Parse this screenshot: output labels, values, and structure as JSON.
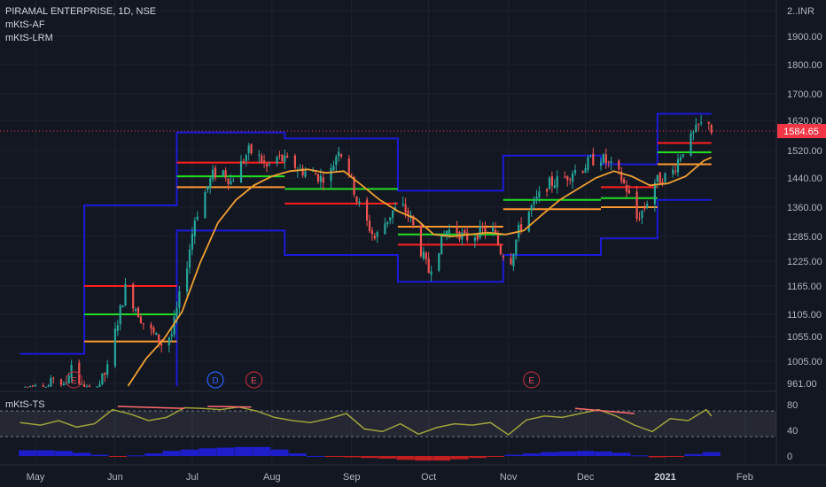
{
  "header": {
    "title": "PIRAMAL ENTERPRISE, 1D, NSE",
    "indicators": [
      "mKtS-AF",
      "mKtS-LRM"
    ],
    "currency": "INR",
    "sub_title": "mKtS-TS"
  },
  "colors": {
    "background": "#131722",
    "up": "#26a69a",
    "down": "#ef5350",
    "channel": "#1a1ad8",
    "ma": "#f0a032",
    "level_red": "#ff1f1f",
    "level_green": "#22dd22",
    "level_orange": "#ff9830",
    "ts_line": "#9fa33a",
    "histogram_pos": "#2020e8",
    "histogram_neg": "#e02020",
    "price_tag": "#f23645"
  },
  "chart_data": {
    "type": "candlestick",
    "title": "PIRAMAL ENTERPRISE, 1D, NSE",
    "currency": "INR",
    "last_price": "1584.65",
    "ylim": [
      945,
      2020
    ],
    "y_ticks": [
      "2...",
      "1900.00",
      "1800.00",
      "1700.00",
      "1620.00",
      "1520.00",
      "1440.00",
      "1360.00",
      "1285.00",
      "1225.00",
      "1165.00",
      "1105.00",
      "1055.00",
      "1005.00",
      "961.00"
    ],
    "x_ticks": [
      "May",
      "Jun",
      "Jul",
      "Aug",
      "Sep",
      "Oct",
      "Nov",
      "Dec",
      "2021",
      "Feb"
    ],
    "events": [
      {
        "label": "E",
        "x": "2020-05-16"
      },
      {
        "label": "D",
        "x": "2020-07-10"
      },
      {
        "label": "E",
        "x": "2020-07-25"
      },
      {
        "label": "E",
        "x": "2020-11-10"
      }
    ],
    "price_path": [
      [
        "2020-04-28",
        940
      ],
      [
        "2020-05-01",
        960
      ],
      [
        "2020-05-05",
        930
      ],
      [
        "2020-05-08",
        975
      ],
      [
        "2020-05-12",
        950
      ],
      [
        "2020-05-15",
        1000
      ],
      [
        "2020-05-19",
        950
      ],
      [
        "2020-05-22",
        930
      ],
      [
        "2020-05-26",
        960
      ],
      [
        "2020-05-29",
        990
      ],
      [
        "2020-06-02",
        1090
      ],
      [
        "2020-06-05",
        1160
      ],
      [
        "2020-06-09",
        1120
      ],
      [
        "2020-06-12",
        1085
      ],
      [
        "2020-06-16",
        1060
      ],
      [
        "2020-06-19",
        1040
      ],
      [
        "2020-06-23",
        1060
      ],
      [
        "2020-06-26",
        1140
      ],
      [
        "2020-06-29",
        1220
      ],
      [
        "2020-07-02",
        1330
      ],
      [
        "2020-07-06",
        1400
      ],
      [
        "2020-07-09",
        1450
      ],
      [
        "2020-07-13",
        1460
      ],
      [
        "2020-07-16",
        1430
      ],
      [
        "2020-07-20",
        1480
      ],
      [
        "2020-07-23",
        1520
      ],
      [
        "2020-07-27",
        1500
      ],
      [
        "2020-07-30",
        1470
      ],
      [
        "2020-08-03",
        1500
      ],
      [
        "2020-08-06",
        1490
      ],
      [
        "2020-08-10",
        1475
      ],
      [
        "2020-08-13",
        1460
      ],
      [
        "2020-08-17",
        1455
      ],
      [
        "2020-08-20",
        1440
      ],
      [
        "2020-08-24",
        1460
      ],
      [
        "2020-08-27",
        1530
      ],
      [
        "2020-08-31",
        1460
      ],
      [
        "2020-09-03",
        1380
      ],
      [
        "2020-09-07",
        1320
      ],
      [
        "2020-09-10",
        1280
      ],
      [
        "2020-09-14",
        1320
      ],
      [
        "2020-09-17",
        1350
      ],
      [
        "2020-09-21",
        1360
      ],
      [
        "2020-09-24",
        1330
      ],
      [
        "2020-09-28",
        1250
      ],
      [
        "2020-10-01",
        1200
      ],
      [
        "2020-10-05",
        1260
      ],
      [
        "2020-10-08",
        1300
      ],
      [
        "2020-10-12",
        1300
      ],
      [
        "2020-10-15",
        1280
      ],
      [
        "2020-10-19",
        1290
      ],
      [
        "2020-10-22",
        1300
      ],
      [
        "2020-10-26",
        1300
      ],
      [
        "2020-10-29",
        1250
      ],
      [
        "2020-11-02",
        1230
      ],
      [
        "2020-11-05",
        1300
      ],
      [
        "2020-11-09",
        1350
      ],
      [
        "2020-11-12",
        1380
      ],
      [
        "2020-11-16",
        1420
      ],
      [
        "2020-11-19",
        1430
      ],
      [
        "2020-11-23",
        1440
      ],
      [
        "2020-11-26",
        1460
      ],
      [
        "2020-11-30",
        1470
      ],
      [
        "2020-12-03",
        1490
      ],
      [
        "2020-12-07",
        1500
      ],
      [
        "2020-12-10",
        1480
      ],
      [
        "2020-12-14",
        1450
      ],
      [
        "2020-12-17",
        1410
      ],
      [
        "2020-12-21",
        1330
      ],
      [
        "2020-12-24",
        1360
      ],
      [
        "2020-12-28",
        1430
      ],
      [
        "2020-12-31",
        1440
      ],
      [
        "2021-01-04",
        1460
      ],
      [
        "2021-01-07",
        1510
      ],
      [
        "2021-01-11",
        1560
      ],
      [
        "2021-01-14",
        1600
      ],
      [
        "2021-01-18",
        1620
      ],
      [
        "2021-01-19",
        1585
      ]
    ],
    "ma_path": [
      [
        "2020-06-06",
        945
      ],
      [
        "2020-06-13",
        1010
      ],
      [
        "2020-06-20",
        1050
      ],
      [
        "2020-06-27",
        1110
      ],
      [
        "2020-07-04",
        1220
      ],
      [
        "2020-07-11",
        1320
      ],
      [
        "2020-07-18",
        1380
      ],
      [
        "2020-07-25",
        1420
      ],
      [
        "2020-08-01",
        1445
      ],
      [
        "2020-08-08",
        1460
      ],
      [
        "2020-08-15",
        1465
      ],
      [
        "2020-08-22",
        1455
      ],
      [
        "2020-08-29",
        1460
      ],
      [
        "2020-09-05",
        1420
      ],
      [
        "2020-09-12",
        1380
      ],
      [
        "2020-09-19",
        1350
      ],
      [
        "2020-09-26",
        1330
      ],
      [
        "2020-10-03",
        1290
      ],
      [
        "2020-10-10",
        1285
      ],
      [
        "2020-10-17",
        1290
      ],
      [
        "2020-10-24",
        1295
      ],
      [
        "2020-10-31",
        1290
      ],
      [
        "2020-11-07",
        1300
      ],
      [
        "2020-11-14",
        1340
      ],
      [
        "2020-11-21",
        1380
      ],
      [
        "2020-11-28",
        1410
      ],
      [
        "2020-12-05",
        1440
      ],
      [
        "2020-12-12",
        1460
      ],
      [
        "2020-12-19",
        1445
      ],
      [
        "2020-12-26",
        1420
      ],
      [
        "2021-01-02",
        1425
      ],
      [
        "2021-01-09",
        1445
      ],
      [
        "2021-01-16",
        1490
      ],
      [
        "2021-01-19",
        1500
      ]
    ],
    "channel_upper": [
      [
        "2020-04-25",
        1020
      ],
      [
        "2020-05-20",
        1020
      ],
      [
        "2020-05-20",
        1365
      ],
      [
        "2020-06-25",
        1365
      ],
      [
        "2020-06-25",
        1580
      ],
      [
        "2020-08-06",
        1580
      ],
      [
        "2020-08-06",
        1560
      ],
      [
        "2020-09-19",
        1560
      ],
      [
        "2020-09-19",
        1405
      ],
      [
        "2020-10-30",
        1405
      ],
      [
        "2020-10-30",
        1505
      ],
      [
        "2020-12-07",
        1505
      ],
      [
        "2020-12-07",
        1480
      ],
      [
        "2020-12-29",
        1480
      ],
      [
        "2020-12-29",
        1640
      ],
      [
        "2021-01-19",
        1640
      ]
    ],
    "channel_lower": [
      [
        "2020-06-25",
        945
      ],
      [
        "2020-06-25",
        1300
      ],
      [
        "2020-08-06",
        1300
      ],
      [
        "2020-08-06",
        1240
      ],
      [
        "2020-09-19",
        1240
      ],
      [
        "2020-09-19",
        1175
      ],
      [
        "2020-10-30",
        1175
      ],
      [
        "2020-10-30",
        1240
      ],
      [
        "2020-12-07",
        1240
      ],
      [
        "2020-12-07",
        1280
      ],
      [
        "2020-12-29",
        1280
      ],
      [
        "2020-12-29",
        1380
      ],
      [
        "2021-01-19",
        1380
      ]
    ],
    "levels": [
      {
        "color": "red",
        "from": "2020-05-20",
        "to": "2020-06-25",
        "y": 1165
      },
      {
        "color": "green",
        "from": "2020-05-20",
        "to": "2020-06-25",
        "y": 1105
      },
      {
        "color": "orange",
        "from": "2020-05-20",
        "to": "2020-06-25",
        "y": 1045
      },
      {
        "color": "red",
        "from": "2020-06-25",
        "to": "2020-08-06",
        "y": 1485
      },
      {
        "color": "green",
        "from": "2020-06-25",
        "to": "2020-08-06",
        "y": 1445
      },
      {
        "color": "orange",
        "from": "2020-06-25",
        "to": "2020-08-06",
        "y": 1415
      },
      {
        "color": "green",
        "from": "2020-08-06",
        "to": "2020-09-19",
        "y": 1410
      },
      {
        "color": "red",
        "from": "2020-08-06",
        "to": "2020-09-19",
        "y": 1370
      },
      {
        "color": "orange",
        "from": "2020-09-19",
        "to": "2020-10-30",
        "y": 1310
      },
      {
        "color": "green",
        "from": "2020-09-19",
        "to": "2020-10-30",
        "y": 1290
      },
      {
        "color": "red",
        "from": "2020-09-19",
        "to": "2020-10-30",
        "y": 1265
      },
      {
        "color": "green",
        "from": "2020-10-30",
        "to": "2020-12-07",
        "y": 1380
      },
      {
        "color": "orange",
        "from": "2020-10-30",
        "to": "2020-12-07",
        "y": 1355
      },
      {
        "color": "red",
        "from": "2020-12-07",
        "to": "2020-12-29",
        "y": 1415
      },
      {
        "color": "green",
        "from": "2020-12-07",
        "to": "2020-12-29",
        "y": 1385
      },
      {
        "color": "orange",
        "from": "2020-12-07",
        "to": "2020-12-29",
        "y": 1360
      },
      {
        "color": "red",
        "from": "2020-12-29",
        "to": "2021-01-19",
        "y": 1545
      },
      {
        "color": "green",
        "from": "2020-12-29",
        "to": "2021-01-19",
        "y": 1515
      },
      {
        "color": "orange",
        "from": "2020-12-29",
        "to": "2021-01-19",
        "y": 1480
      }
    ],
    "ts": {
      "y_ticks": [
        "80",
        "40",
        "0"
      ],
      "ylim": [
        -10,
        90
      ],
      "bands": [
        70,
        30
      ],
      "path": [
        [
          "2020-04-25",
          52
        ],
        [
          "2020-05-03",
          48
        ],
        [
          "2020-05-10",
          55
        ],
        [
          "2020-05-17",
          45
        ],
        [
          "2020-05-24",
          50
        ],
        [
          "2020-05-31",
          72
        ],
        [
          "2020-06-07",
          65
        ],
        [
          "2020-06-14",
          55
        ],
        [
          "2020-06-21",
          60
        ],
        [
          "2020-06-28",
          75
        ],
        [
          "2020-07-05",
          74
        ],
        [
          "2020-07-12",
          72
        ],
        [
          "2020-07-19",
          76
        ],
        [
          "2020-07-26",
          70
        ],
        [
          "2020-08-02",
          60
        ],
        [
          "2020-08-09",
          55
        ],
        [
          "2020-08-16",
          52
        ],
        [
          "2020-08-23",
          58
        ],
        [
          "2020-08-30",
          66
        ],
        [
          "2020-09-06",
          42
        ],
        [
          "2020-09-13",
          38
        ],
        [
          "2020-09-20",
          50
        ],
        [
          "2020-09-27",
          34
        ],
        [
          "2020-10-04",
          44
        ],
        [
          "2020-10-11",
          50
        ],
        [
          "2020-10-18",
          48
        ],
        [
          "2020-10-25",
          52
        ],
        [
          "2020-11-01",
          33
        ],
        [
          "2020-11-08",
          56
        ],
        [
          "2020-11-15",
          62
        ],
        [
          "2020-11-22",
          60
        ],
        [
          "2020-11-29",
          66
        ],
        [
          "2020-12-06",
          72
        ],
        [
          "2020-12-13",
          62
        ],
        [
          "2020-12-20",
          48
        ],
        [
          "2020-12-27",
          38
        ],
        [
          "2021-01-03",
          58
        ],
        [
          "2021-01-10",
          55
        ],
        [
          "2021-01-17",
          72
        ],
        [
          "2021-01-19",
          62
        ]
      ],
      "signal_segments": [
        [
          [
            "2020-06-02",
            77
          ],
          [
            "2020-06-28",
            74
          ]
        ],
        [
          [
            "2020-07-07",
            77
          ],
          [
            "2020-07-24",
            76
          ]
        ],
        [
          [
            "2020-11-27",
            74
          ],
          [
            "2020-12-20",
            66
          ]
        ]
      ],
      "histogram": [
        [
          "2020-04-28",
          9
        ],
        [
          "2020-05-05",
          9
        ],
        [
          "2020-05-12",
          8
        ],
        [
          "2020-05-19",
          5
        ],
        [
          "2020-05-26",
          2
        ],
        [
          "2020-06-02",
          -1
        ],
        [
          "2020-06-09",
          1
        ],
        [
          "2020-06-16",
          4
        ],
        [
          "2020-06-23",
          8
        ],
        [
          "2020-06-30",
          10
        ],
        [
          "2020-07-07",
          12
        ],
        [
          "2020-07-14",
          13
        ],
        [
          "2020-07-21",
          14
        ],
        [
          "2020-07-28",
          14
        ],
        [
          "2020-08-04",
          10
        ],
        [
          "2020-08-11",
          4
        ],
        [
          "2020-08-18",
          0
        ],
        [
          "2020-08-25",
          -1
        ],
        [
          "2020-09-01",
          -2
        ],
        [
          "2020-09-08",
          -3
        ],
        [
          "2020-09-15",
          -4
        ],
        [
          "2020-09-22",
          -6
        ],
        [
          "2020-09-29",
          -7
        ],
        [
          "2020-10-06",
          -7
        ],
        [
          "2020-10-13",
          -5
        ],
        [
          "2020-10-20",
          -3
        ],
        [
          "2020-10-27",
          -1
        ],
        [
          "2020-11-03",
          2
        ],
        [
          "2020-11-10",
          4
        ],
        [
          "2020-11-17",
          6
        ],
        [
          "2020-11-24",
          7
        ],
        [
          "2020-12-01",
          8
        ],
        [
          "2020-12-08",
          7
        ],
        [
          "2020-12-15",
          5
        ],
        [
          "2020-12-22",
          1
        ],
        [
          "2020-12-29",
          -2
        ],
        [
          "2021-01-05",
          -1
        ],
        [
          "2021-01-12",
          3
        ],
        [
          "2021-01-19",
          6
        ]
      ]
    }
  }
}
